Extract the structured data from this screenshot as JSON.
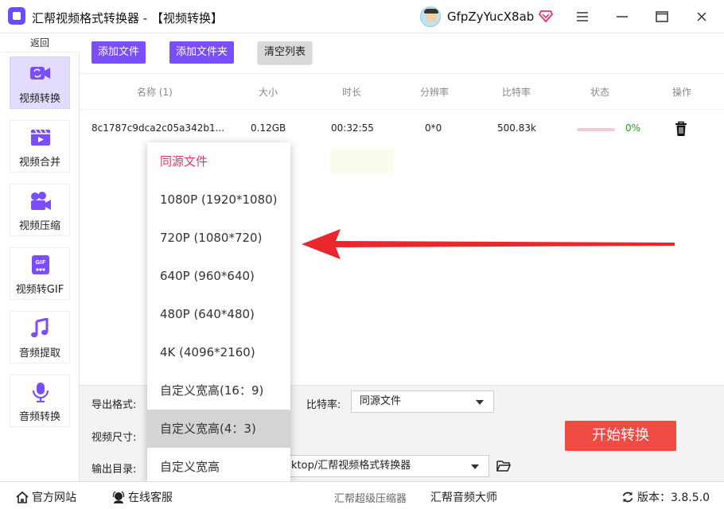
{
  "window": {
    "title": "汇帮视频格式转换器 - 【视频转换】",
    "username": "GfpZyYucX8ab",
    "controls": [
      "menu-icon",
      "minimize-icon",
      "maximize-icon",
      "close-icon"
    ]
  },
  "sidebar": {
    "back_label": "返回",
    "items": [
      {
        "label": "视频转换",
        "icon": "video-convert-icon",
        "active": true
      },
      {
        "label": "视频合并",
        "icon": "video-merge-icon"
      },
      {
        "label": "视频压缩",
        "icon": "video-compress-icon"
      },
      {
        "label": "视频转GIF",
        "icon": "gif-icon"
      },
      {
        "label": "音频提取",
        "icon": "music-note-icon"
      },
      {
        "label": "音频转换",
        "icon": "microphone-icon"
      }
    ]
  },
  "toolbar": {
    "add_file": "添加文件",
    "add_folder": "添加文件夹",
    "clear_list": "清空列表"
  },
  "table": {
    "columns": [
      "名称 (1)",
      "大小",
      "时长",
      "分辨率",
      "比特率",
      "状态",
      "操作"
    ],
    "rows": [
      {
        "name": "8c1787c9dca2c05a342b1...",
        "size": "0.12GB",
        "duration": "00:32:55",
        "resolution": "0*0",
        "bitrate": "500.83k",
        "progress": 0,
        "progress_text": "0%"
      }
    ]
  },
  "settings": {
    "format_label": "导出格式:",
    "size_label": "视频尺寸:",
    "output_label": "输出目录:",
    "bitrate_label": "比特率:",
    "bitrate_value": "同源文件",
    "output_value": "ktop/汇帮视频格式转换器",
    "start_button": "开始转换"
  },
  "dropdown": {
    "options": [
      "同源文件",
      "1080P (1920*1080)",
      "720P (1080*720)",
      "640P (960*640)",
      "480P (640*480)",
      "4K (4096*2160)",
      "自定义宽高(16：9)",
      "自定义宽高(4：3)",
      "自定义宽高"
    ],
    "selected_index": 0,
    "hover_index": 7
  },
  "footer": {
    "website": "官方网站",
    "support": "在线客服",
    "compressor": "汇帮超级压缩器",
    "audio_master": "汇帮音频大师",
    "version": "版本：3.8.5.0"
  },
  "colors": {
    "accent": "#7a4dff",
    "start": "#ef4b42",
    "selected_option": "#e0336b",
    "progress_text": "#19a319",
    "annotation_arrow": "#e8282d"
  }
}
